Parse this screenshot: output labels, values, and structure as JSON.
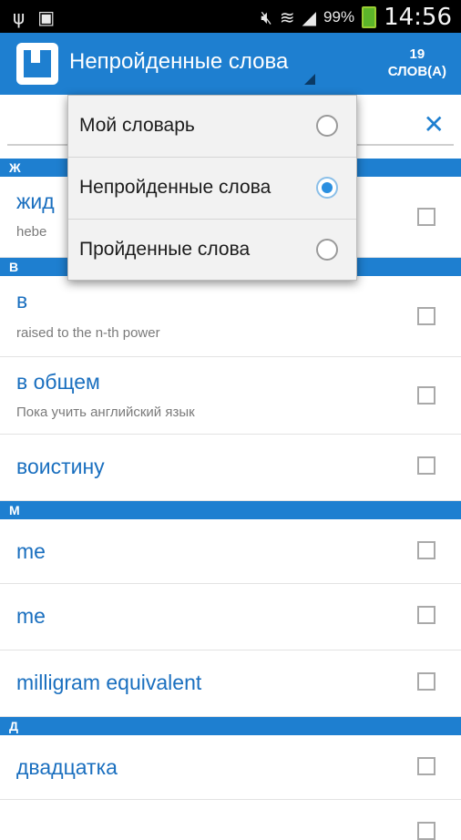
{
  "statusbar": {
    "battery": "99%",
    "time": "14:56",
    "icons": [
      "usb-icon",
      "image-icon",
      "mute-icon",
      "wifi-icon",
      "signal-icon",
      "battery-icon"
    ]
  },
  "appbar": {
    "title": "Непройденные слова",
    "count_number": "19",
    "count_label": "СЛОВ(А)",
    "accent_color": "#1e7fd0"
  },
  "search": {
    "value": "",
    "placeholder": ""
  },
  "dropdown": {
    "items": [
      {
        "label": "Мой словарь",
        "selected": false
      },
      {
        "label": "Непройденные слова",
        "selected": true
      },
      {
        "label": "Пройденные слова",
        "selected": false
      }
    ]
  },
  "sections": [
    {
      "letter": "Ж",
      "rows": [
        {
          "word": "жид",
          "translation": "hebe"
        }
      ]
    },
    {
      "letter": "В",
      "rows": [
        {
          "word": "в",
          "translation": "raised to the n-th power"
        },
        {
          "word": "в общем",
          "translation": "Пока учить английский язык"
        },
        {
          "word": "воистину",
          "translation": ""
        }
      ]
    },
    {
      "letter": "М",
      "rows": [
        {
          "word": "me",
          "translation": ""
        },
        {
          "word": "me",
          "translation": ""
        },
        {
          "word": "milligram equivalent",
          "translation": ""
        }
      ]
    },
    {
      "letter": "Д",
      "rows": [
        {
          "word": "двадцатка",
          "translation": ""
        }
      ]
    }
  ]
}
